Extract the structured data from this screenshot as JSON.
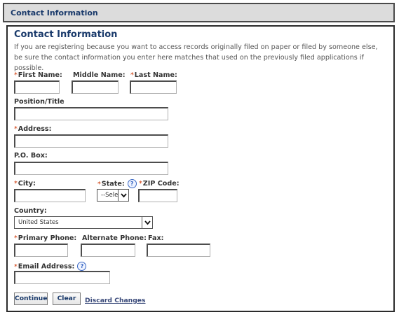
{
  "header": {
    "title": "Contact Information"
  },
  "panel": {
    "title": "Contact Information",
    "intro": "If you are registering because you want to access records originally filed on paper or filed by someone else, be sure the contact information you enter here matches that used on the previously filed applications if possible."
  },
  "fields": {
    "first_name": {
      "label": "First Name:",
      "value": ""
    },
    "middle_name": {
      "label": "Middle Name:",
      "value": ""
    },
    "last_name": {
      "label": "Last Name:",
      "value": ""
    },
    "position": {
      "label": "Position/Title",
      "value": ""
    },
    "address": {
      "label": "Address:",
      "value": ""
    },
    "po_box": {
      "label": "P.O. Box:",
      "value": ""
    },
    "city": {
      "label": "City:",
      "value": ""
    },
    "state": {
      "label": "State:",
      "selected": "--Sele"
    },
    "zip": {
      "label": "ZIP Code:",
      "value": ""
    },
    "country": {
      "label": "Country:",
      "selected": "United States"
    },
    "primary_phone": {
      "label": "Primary Phone:",
      "value": ""
    },
    "alternate_phone": {
      "label": "Alternate Phone:",
      "value": ""
    },
    "fax": {
      "label": "Fax:",
      "value": ""
    },
    "email": {
      "label": "Email Address:",
      "value": ""
    }
  },
  "required_marker": "*",
  "help_glyph": "?",
  "buttons": {
    "continue": "Continue",
    "clear": "Clear",
    "discard": "Discard Changes"
  },
  "colors": {
    "required": "#cc3300",
    "title": "#1a3a6b",
    "help": "#3a68c4"
  },
  "icons": {
    "help": "help-icon",
    "dropdown": "chevron-down-icon"
  }
}
